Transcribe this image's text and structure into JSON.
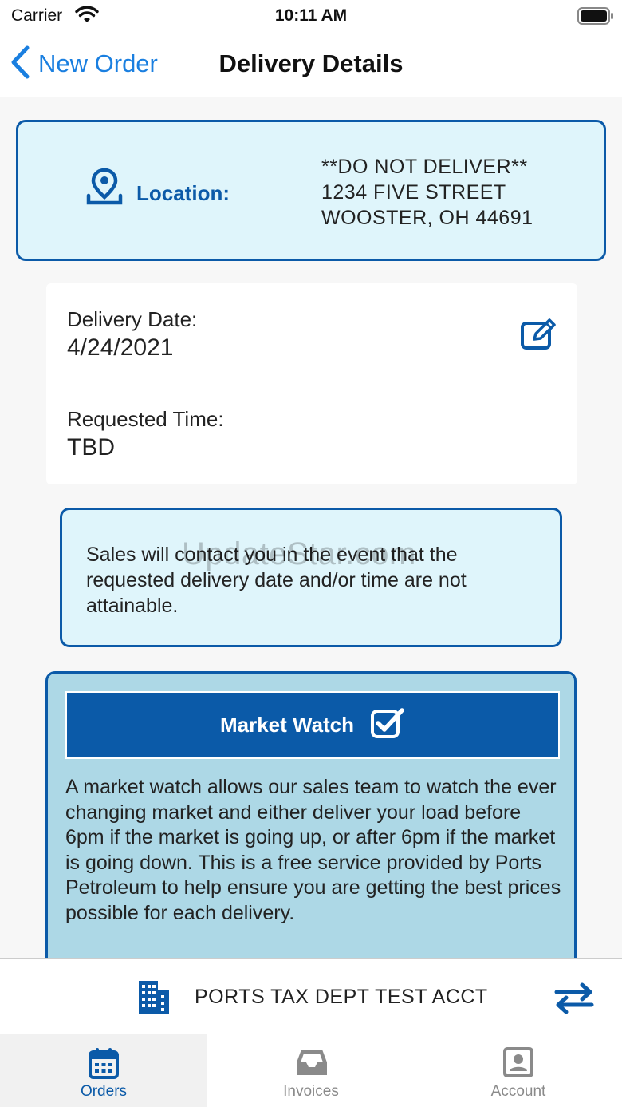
{
  "status_bar": {
    "carrier": "Carrier",
    "time": "10:11 AM"
  },
  "nav": {
    "back_label": "New Order",
    "title": "Delivery Details"
  },
  "location": {
    "label": "Location:",
    "address_lines": [
      "**DO NOT DELIVER**",
      "1234 FIVE STREET",
      "WOOSTER, OH 44691"
    ]
  },
  "delivery": {
    "date_label": "Delivery Date:",
    "date_value": "4/24/2021",
    "time_label": "Requested Time:",
    "time_value": "TBD"
  },
  "notice": {
    "text": "Sales will contact you in the event that the requested delivery date and/or time are not attainable."
  },
  "watermark": "UpdateStar.com",
  "market_watch": {
    "button_label": "Market Watch",
    "checked": true,
    "description": "A market watch allows our sales team to watch the ever changing market and either deliver your load before 6pm if the market is going up, or after 6pm if the market is going down. This is a free service provided by Ports Petroleum to help ensure you are getting the best prices possible for each delivery."
  },
  "account": {
    "name": "PORTS TAX DEPT TEST ACCT"
  },
  "tabs": [
    {
      "label": "Orders",
      "icon": "calendar-icon",
      "active": true
    },
    {
      "label": "Invoices",
      "icon": "inbox-icon",
      "active": false
    },
    {
      "label": "Account",
      "icon": "account-icon",
      "active": false
    }
  ],
  "colors": {
    "brand_blue": "#0b5aa8",
    "link_blue": "#1a7fe0",
    "card_light": "#dff5fb",
    "market_bg": "#add8e6"
  }
}
